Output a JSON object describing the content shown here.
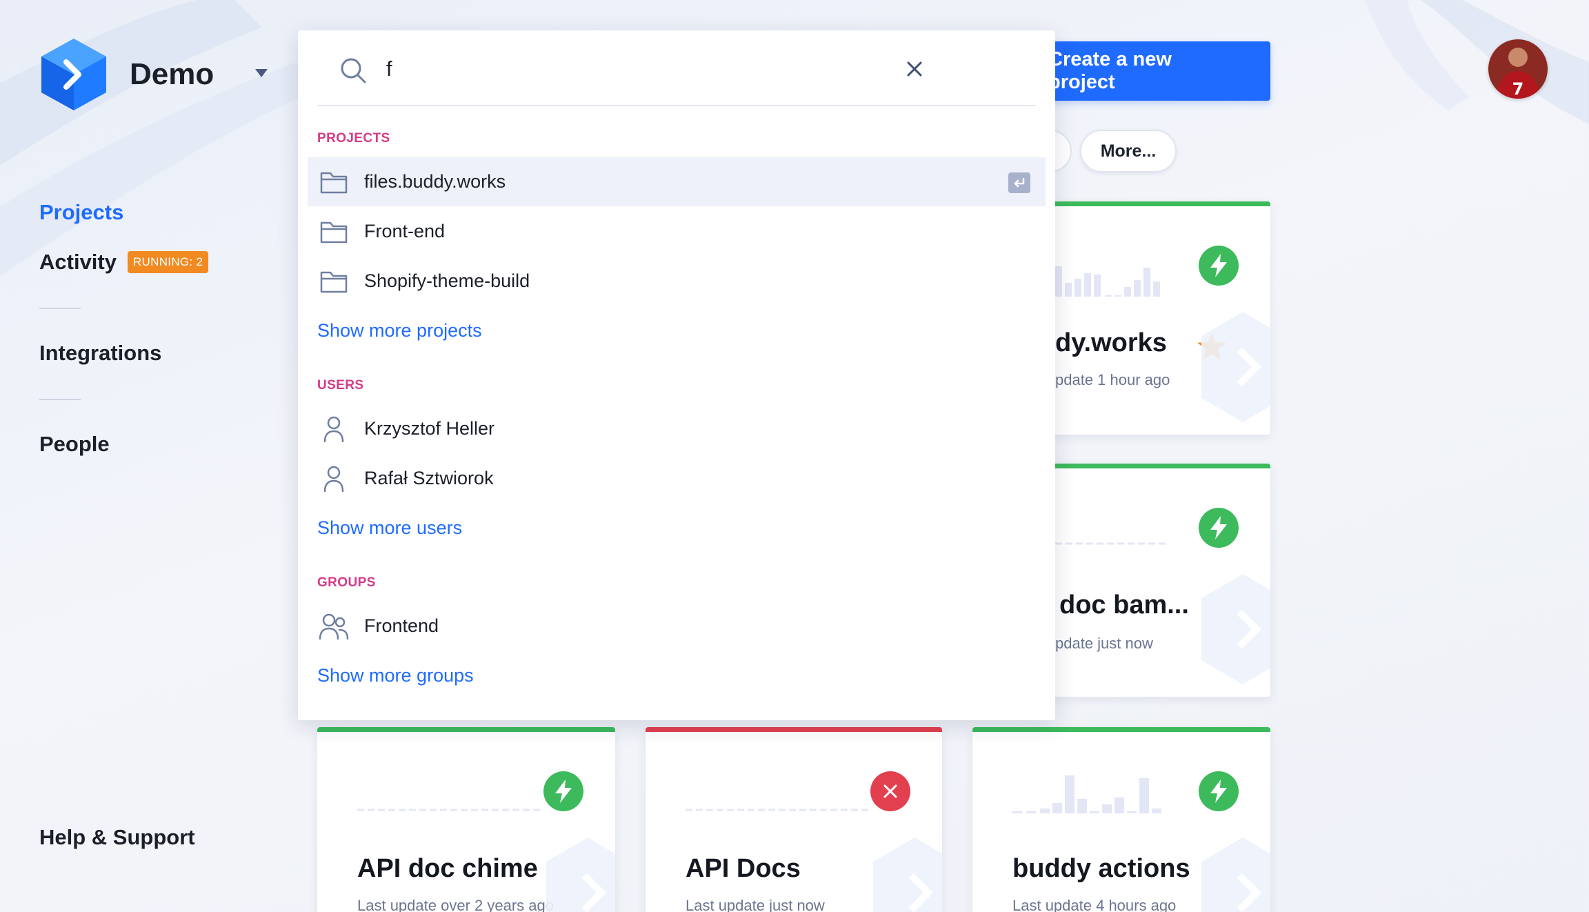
{
  "brand": {
    "name": "Demo"
  },
  "nav": {
    "projects": "Projects",
    "activity": "Activity",
    "running_badge": "RUNNING: 2",
    "integrations": "Integrations",
    "people": "People",
    "help": "Help & Support"
  },
  "header": {
    "create_label": "Create a new project",
    "more_label": "More..."
  },
  "search": {
    "query": "f",
    "sections": {
      "projects_label": "PROJECTS",
      "users_label": "USERS",
      "groups_label": "GROUPS"
    },
    "projects": [
      "files.buddy.works",
      "Front-end",
      "Shopify-theme-build"
    ],
    "show_more_projects": "Show more projects",
    "users": [
      "Krzysztof Heller",
      "Rafał Sztwiorok"
    ],
    "show_more_users": "Show more users",
    "groups": [
      "Frontend"
    ],
    "show_more_groups": "Show more groups"
  },
  "cards": [
    {
      "title": "dy.works",
      "subtitle": "pdate 1 hour ago",
      "status": "ok",
      "starred": true
    },
    {
      "title": "doc bam...",
      "subtitle": "pdate just now",
      "status": "ok",
      "starred": false
    },
    {
      "title": "API doc chime",
      "subtitle": "Last update over 2 years ago",
      "status": "ok",
      "starred": false
    },
    {
      "title": "API Docs",
      "subtitle": "Last update just now",
      "status": "fail",
      "starred": false
    },
    {
      "title": "buddy actions",
      "subtitle": "Last update 4 hours ago",
      "status": "ok",
      "starred": false
    }
  ],
  "colors": {
    "accent": "#1f6bff",
    "section_label": "#d63a87",
    "success": "#3dba5c",
    "failure": "#e2404f",
    "badge": "#f28a22"
  }
}
